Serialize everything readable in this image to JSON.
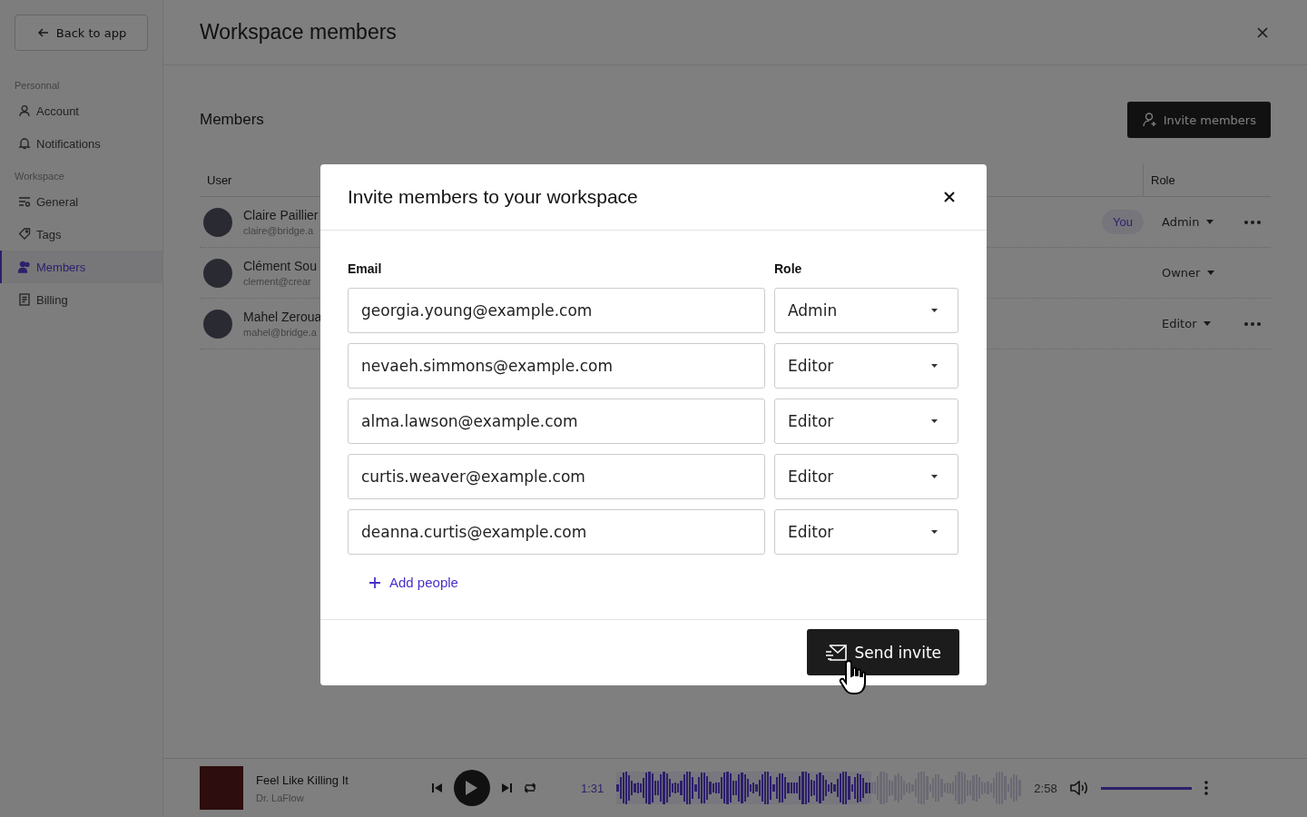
{
  "sidebar": {
    "back_button": "Back to app",
    "sections": [
      {
        "heading": "Personnal",
        "items": [
          {
            "label": "Account",
            "selected": false
          },
          {
            "label": "Notifications",
            "selected": false
          }
        ]
      },
      {
        "heading": "Workspace",
        "items": [
          {
            "label": "General",
            "selected": false
          },
          {
            "label": "Tags",
            "selected": false
          },
          {
            "label": "Members",
            "selected": true
          },
          {
            "label": "Billing",
            "selected": false
          }
        ]
      }
    ]
  },
  "header": {
    "title": "Workspace members"
  },
  "members": {
    "title": "Members",
    "invite_button": "Invite members",
    "columns": [
      "User",
      "Role"
    ],
    "rows": [
      {
        "name": "Claire Paillier",
        "email": "claire@bridge.a",
        "badge": "You",
        "role": "Admin",
        "menu": true
      },
      {
        "name": "Clément Sou",
        "email": "clement@crear",
        "role": "Owner",
        "menu": false
      },
      {
        "name": "Mahel Zeroua",
        "email": "mahel@bridge.a",
        "role": "Editor",
        "menu": true
      }
    ]
  },
  "modal": {
    "title": "Invite members to your workspace",
    "email_label": "Email",
    "role_label": "Role",
    "invites": [
      {
        "email": "georgia.young@example.com",
        "role": "Admin"
      },
      {
        "email": "nevaeh.simmons@example.com",
        "role": "Editor"
      },
      {
        "email": "alma.lawson@example.com",
        "role": "Editor"
      },
      {
        "email": "curtis.weaver@example.com",
        "role": "Editor"
      },
      {
        "email": "deanna.curtis@example.com",
        "role": "Editor"
      }
    ],
    "add_link": "Add people",
    "send_button": "Send invite"
  },
  "player": {
    "title": "Feel Like Killing It",
    "artist": "Dr. LaFlow",
    "elapsed": "1:31",
    "duration": "2:58",
    "progress": {
      "level": 0.63
    },
    "volume": {
      "level": 1.0
    }
  }
}
